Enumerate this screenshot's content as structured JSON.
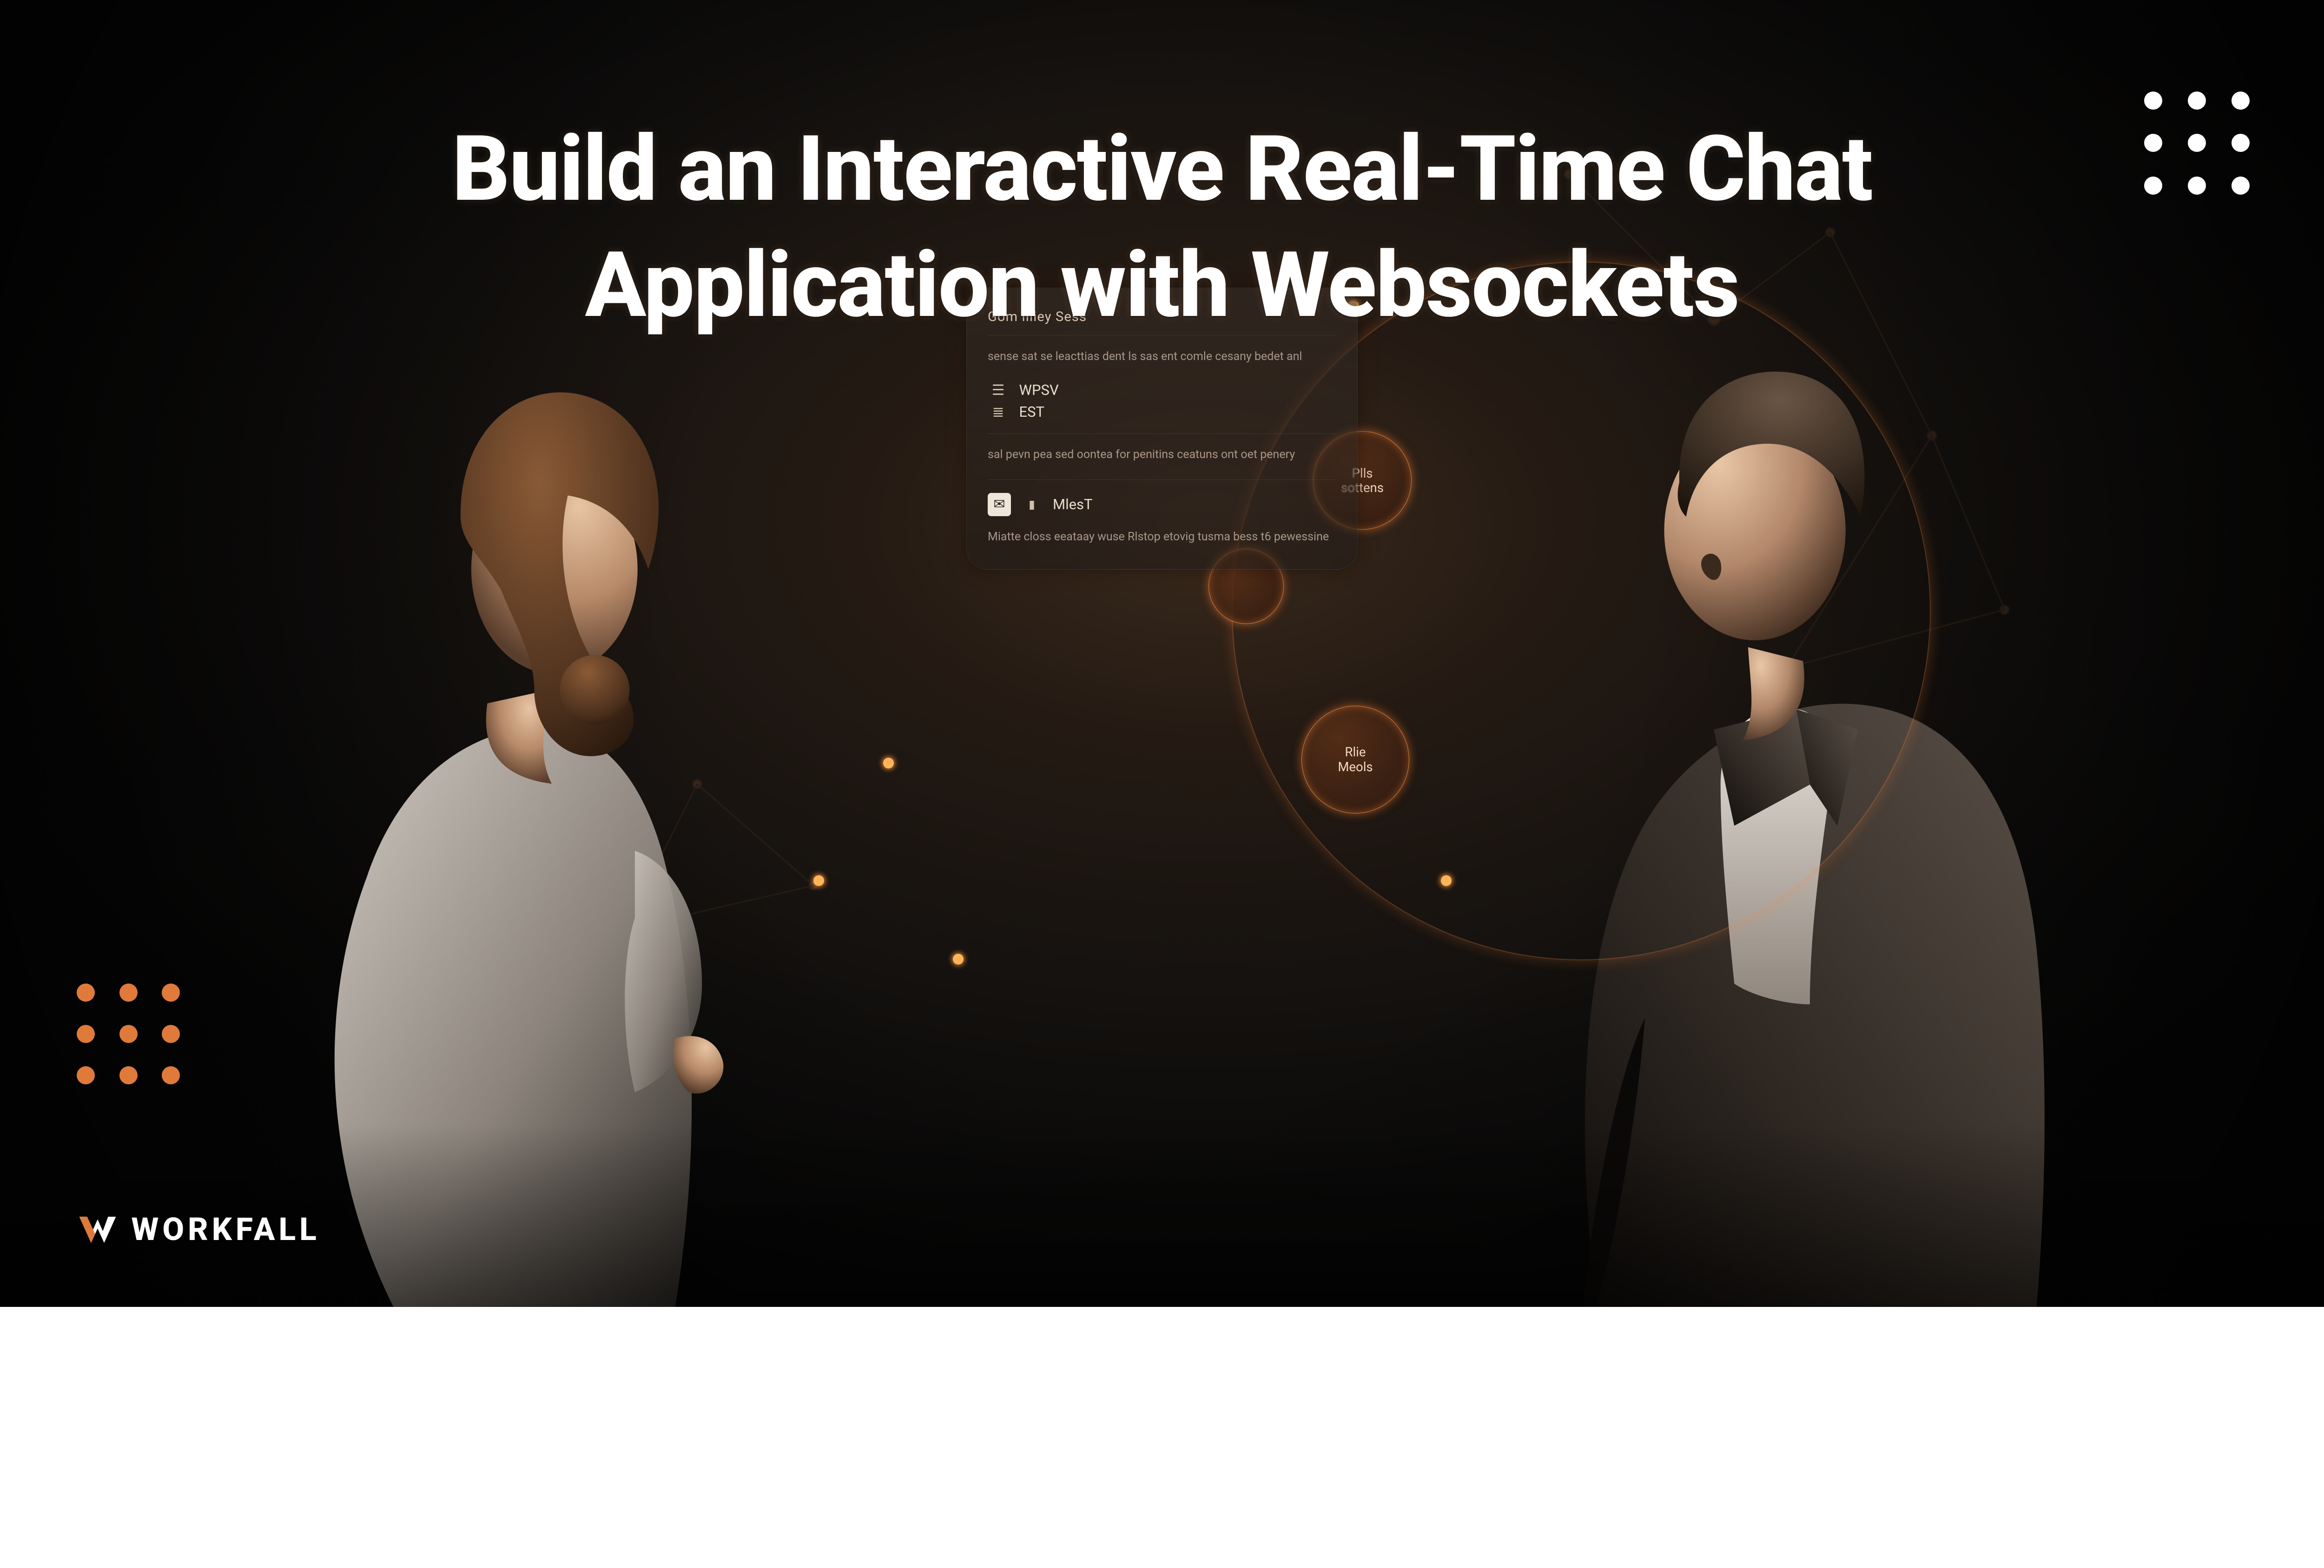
{
  "title_line1": "Build an Interactive Real-Time Chat",
  "title_line2": "Application with Websockets",
  "brand": "WORKFALL",
  "panel": {
    "header": "Gom llliey Sess",
    "block1": "sense sat se leacttias dent ls sas ent comle cesany bedet anl",
    "row1": "WPSV",
    "row2": "EST",
    "block2": "sal pevn pea sed oontea for penitins ceatuns ont oet penery",
    "row3": "MlesT",
    "block3": "Miatte closs eeataay wuse Rlstop etovig tusma bess t6 pewessine"
  },
  "nodes": {
    "a_l1": "Plls",
    "a_l2": "sottens",
    "b_l1": "Rlie",
    "b_l2": "Meols"
  },
  "colors": {
    "accent": "#e07a3a",
    "glow": "#ff8c3c"
  }
}
